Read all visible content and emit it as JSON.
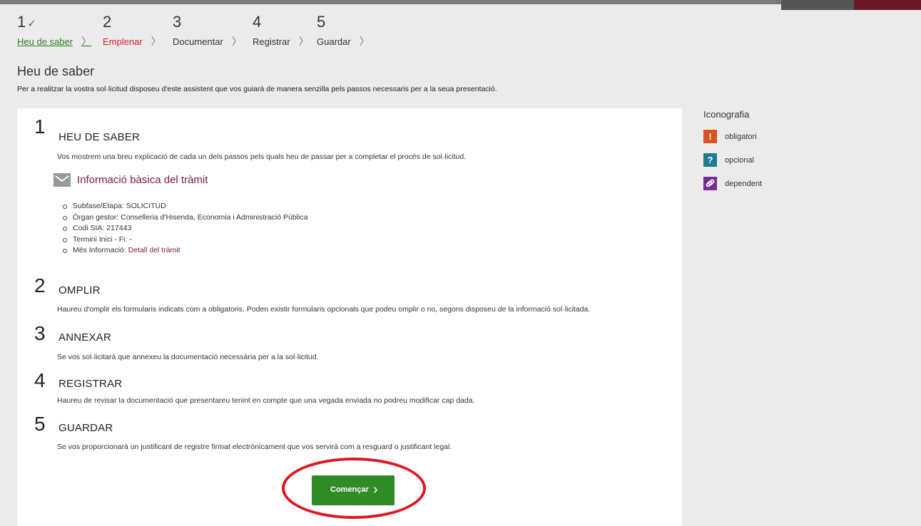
{
  "steps": [
    {
      "number": "1",
      "check": "✓",
      "label": "Heu de saber",
      "state": "done"
    },
    {
      "number": "2",
      "label": "Emplenar",
      "state": "active"
    },
    {
      "number": "3",
      "label": "Documentar",
      "state": "pending"
    },
    {
      "number": "4",
      "label": "Registrar",
      "state": "pending"
    },
    {
      "number": "5",
      "label": "Guardar",
      "state": "pending"
    }
  ],
  "step_separator": "〉",
  "page": {
    "title": "Heu de saber",
    "intro": "Per a realitzar la vostra sol·licitud disposeu d'este assistent que vos guiarà de manera senzilla pels passos necessaris per a la seua presentació."
  },
  "sections": [
    {
      "number": "1",
      "title": "HEU DE SABER",
      "description": "Vos mostrem una breu explicació de cada un dels passos pels quals heu de passar per a completar el procés de sol·licitud."
    },
    {
      "number": "2",
      "title": "OMPLIR",
      "description": "Haureu d'omplir els formularis indicats com a obligatoris. Poden existir formularis opcionals que podeu omplir o no, segons disposeu de la informació sol·licitada."
    },
    {
      "number": "3",
      "title": "ANNEXAR",
      "description": "Se vos sol·licitarà que annexeu la documentació necessària per a la sol·licitud."
    },
    {
      "number": "4",
      "title": "REGISTRAR",
      "description": "Haureu de revisar la documentació que presentareu tenint en compte que una vegada enviada no podreu modificar cap dada."
    },
    {
      "number": "5",
      "title": "GUARDAR",
      "description": "Se vos proporcionarà un justificant de registre firmat electrònicament que vos servirà com a resguard o justificant legal."
    }
  ],
  "info": {
    "title": "Informació bàsica del tràmit",
    "icon": "envelope-icon",
    "items": [
      "Subfase/Etapa: SOLICITUD",
      "Òrgan gestor: Conselleria d'Hisenda, Economia i Administració Pública",
      "Codi SIA: 217443",
      "Termini Inici - Fi: -"
    ],
    "more_label": "Més Informació: ",
    "more_link": "Detall del tràmit"
  },
  "start_button": {
    "label": "Començar",
    "chevron": "›"
  },
  "legend": {
    "title": "Iconografia",
    "items": [
      {
        "symbol": "!",
        "label": "obligatori",
        "color": "#d9531e",
        "icon": "exclamation-icon"
      },
      {
        "symbol": "?",
        "label": "opcional",
        "color": "#1c7a94",
        "icon": "question-icon"
      },
      {
        "symbol": "🔗",
        "label": "dependent",
        "color": "#7a2a91",
        "icon": "link-icon"
      }
    ]
  },
  "colors": {
    "brand_red": "#7a1f2b",
    "done_green": "#2e7d22",
    "active_red": "#d8232a",
    "button_green": "#2e8b26",
    "highlight": "#e2161f"
  }
}
